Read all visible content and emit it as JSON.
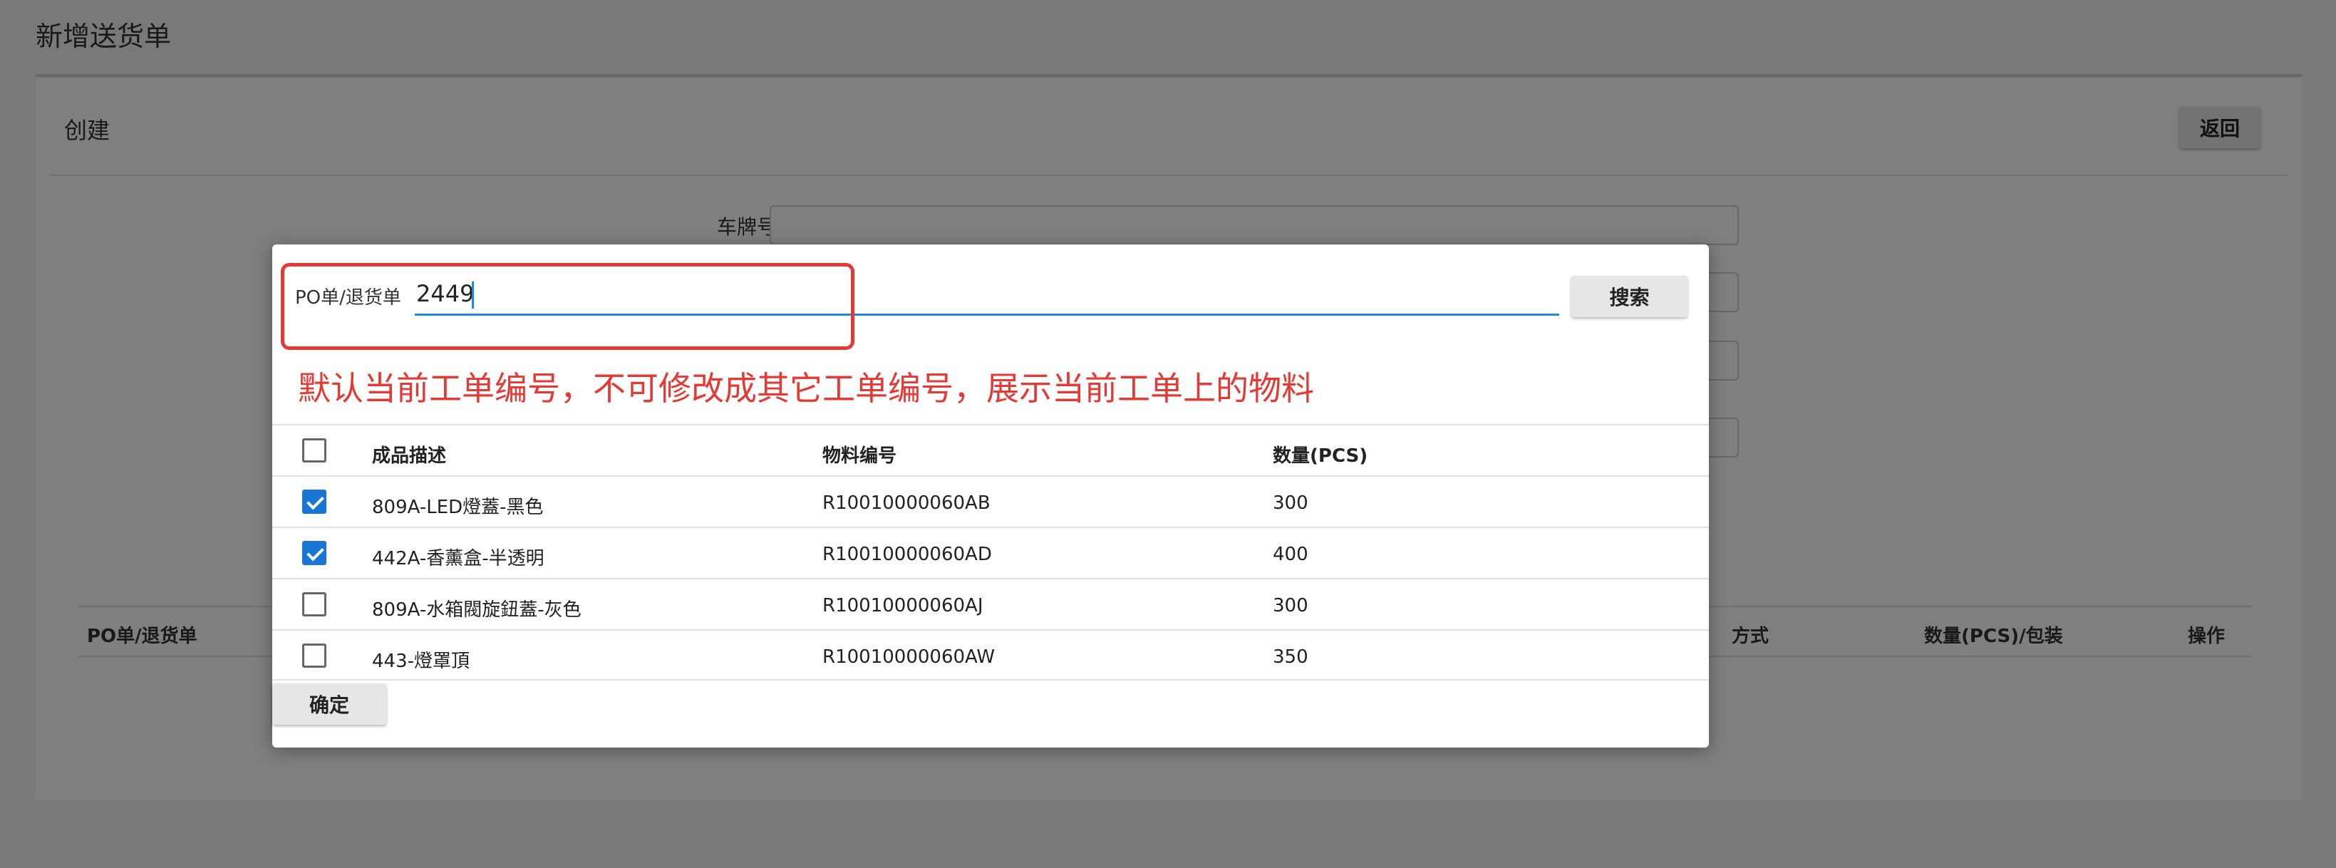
{
  "page": {
    "title": "新增送货单"
  },
  "card": {
    "title": "创建",
    "back_label": "返回"
  },
  "form": {
    "plate_label": "车牌号"
  },
  "background_table": {
    "headers": [
      "PO单/退货单",
      "方式",
      "数量(PCS)/包装",
      "操作"
    ]
  },
  "modal": {
    "search": {
      "label": "PO单/退货单",
      "value": "2449",
      "button_label": "搜索"
    },
    "annotation": "默认当前工单编号，不可修改成其它工单编号，展示当前工单上的物料",
    "table": {
      "headers": [
        "成品描述",
        "物料编号",
        "数量(PCS)"
      ],
      "rows": [
        {
          "checked": true,
          "desc": "809A-LED燈蓋-黑色",
          "code": "R10010000060AB",
          "qty": "300"
        },
        {
          "checked": true,
          "desc": "442A-香薰盒-半透明",
          "code": "R10010000060AD",
          "qty": "400"
        },
        {
          "checked": false,
          "desc": "809A-水箱閥旋鈕蓋-灰色",
          "code": "R10010000060AJ",
          "qty": "300"
        },
        {
          "checked": false,
          "desc": "443-燈罩頂",
          "code": "R10010000060AW",
          "qty": "350"
        }
      ]
    },
    "confirm_label": "确定"
  },
  "colors": {
    "accent": "#1976d2",
    "annotation": "#e53935",
    "bg_yellow": "#f5c518",
    "bg_blue": "#1565c0"
  }
}
